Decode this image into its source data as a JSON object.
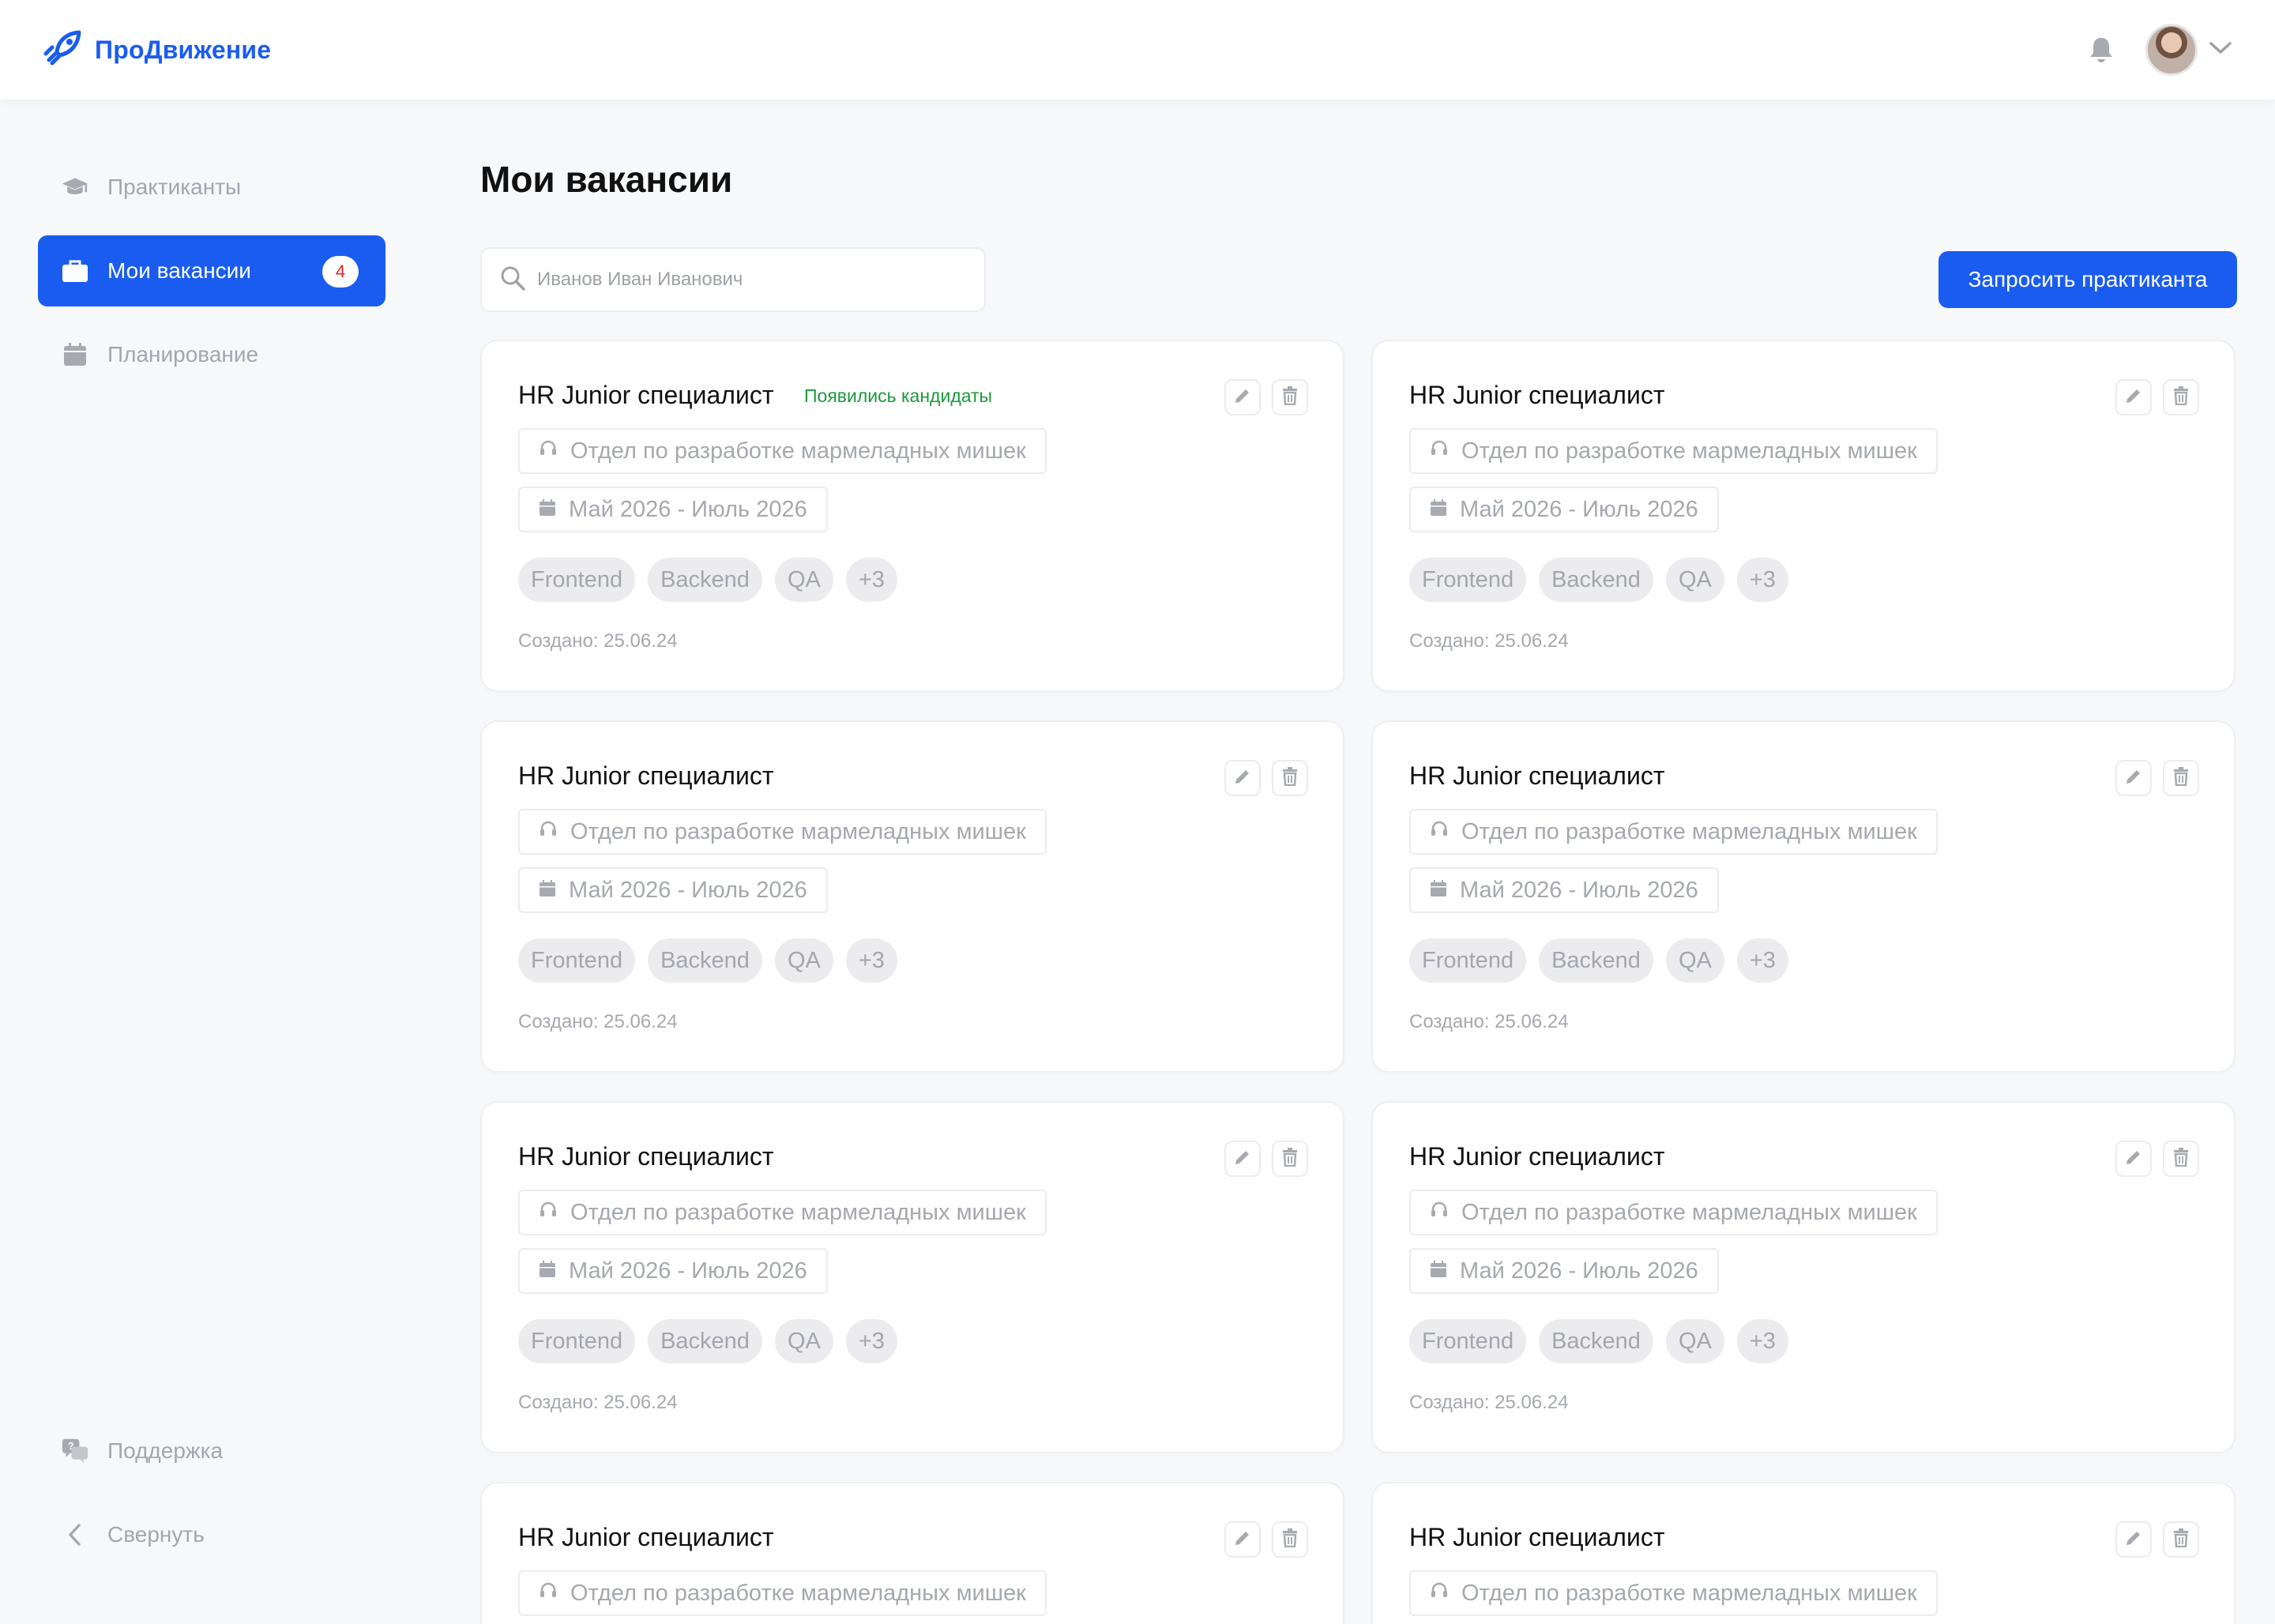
{
  "header": {
    "logo_text": "ПроДвижение"
  },
  "sidebar": {
    "items": [
      {
        "label": "Практиканты"
      },
      {
        "label": "Мои вакансии",
        "badge": "4"
      },
      {
        "label": "Планирование"
      }
    ],
    "support_label": "Поддержка",
    "collapse_label": "Свернуть"
  },
  "main": {
    "title": "Мои вакансии",
    "search": {
      "placeholder": "Иванов Иван Иванович",
      "value": ""
    },
    "request_button": "Запросить практиканта",
    "cards": [
      {
        "title": "HR Junior специалист",
        "status": "Появились кандидаты",
        "department": "Отдел по разработке мармеладных мишек",
        "period": "Май 2026 - Июль 2026",
        "tags": [
          "Frontend",
          "Backend",
          "QA",
          "+3"
        ],
        "created": "Создано: 25.06.24"
      },
      {
        "title": "HR Junior специалист",
        "status": "",
        "department": "Отдел по разработке мармеладных мишек",
        "period": "Май 2026 - Июль 2026",
        "tags": [
          "Frontend",
          "Backend",
          "QA",
          "+3"
        ],
        "created": "Создано: 25.06.24"
      },
      {
        "title": "HR Junior специалист",
        "status": "",
        "department": "Отдел по разработке мармеладных мишек",
        "period": "Май 2026 - Июль 2026",
        "tags": [
          "Frontend",
          "Backend",
          "QA",
          "+3"
        ],
        "created": "Создано: 25.06.24"
      },
      {
        "title": "HR Junior специалист",
        "status": "",
        "department": "Отдел по разработке мармеладных мишек",
        "period": "Май 2026 - Июль 2026",
        "tags": [
          "Frontend",
          "Backend",
          "QA",
          "+3"
        ],
        "created": "Создано: 25.06.24"
      },
      {
        "title": "HR Junior специалист",
        "status": "",
        "department": "Отдел по разработке мармеладных мишек",
        "period": "Май 2026 - Июль 2026",
        "tags": [
          "Frontend",
          "Backend",
          "QA",
          "+3"
        ],
        "created": "Создано: 25.06.24"
      },
      {
        "title": "HR Junior специалист",
        "status": "",
        "department": "Отдел по разработке мармеладных мишек",
        "period": "Май 2026 - Июль 2026",
        "tags": [
          "Frontend",
          "Backend",
          "QA",
          "+3"
        ],
        "created": "Создано: 25.06.24"
      },
      {
        "title": "HR Junior специалист",
        "status": "",
        "department": "Отдел по разработке мармеладных мишек",
        "period": "",
        "tags": [],
        "created": ""
      },
      {
        "title": "HR Junior специалист",
        "status": "",
        "department": "Отдел по разработке мармеладных мишек",
        "period": "",
        "tags": [],
        "created": ""
      }
    ]
  },
  "colors": {
    "accent": "#1a5cf0",
    "status_green": "#1a9a3c",
    "badge_red": "#e0242c"
  },
  "icons": [
    "rocket-logo-icon",
    "bell-icon",
    "chevron-down-icon",
    "graduation-cap-icon",
    "briefcase-icon",
    "calendar-icon",
    "search-icon",
    "headset-icon",
    "pencil-icon",
    "trash-icon",
    "support-chat-icon",
    "chevron-left-icon"
  ]
}
